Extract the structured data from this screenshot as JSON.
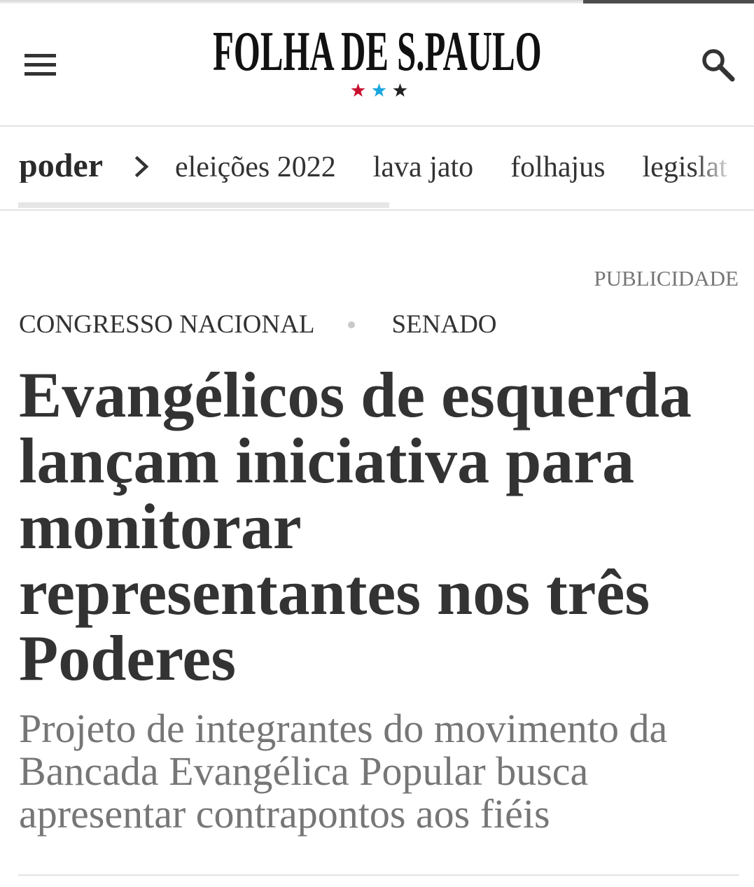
{
  "header": {
    "logo_text": "FOLHA DE S.PAULO",
    "star_colors": [
      "#c8102e",
      "#1ba6e0",
      "#222222"
    ]
  },
  "icons": {
    "menu": "hamburger-menu-icon",
    "search": "search-icon",
    "chevron": "chevron-right-icon",
    "logo_stars": "star-icon"
  },
  "nav": {
    "current_section": "poder",
    "items": [
      "eleições 2022",
      "lava jato",
      "folhajus",
      "legislat"
    ]
  },
  "ad": {
    "label": "PUBLICIDADE"
  },
  "article": {
    "kicker": [
      "CONGRESSO NACIONAL",
      "SENADO"
    ],
    "headline": "Evangélicos de esquerda lançam iniciativa para monitorar representantes nos três Poderes",
    "subtitle": "Projeto de integrantes do movimento da Bancada Evangélica Popular busca apresentar contrapontos aos fiéis"
  },
  "colors": {
    "text": "#333333",
    "muted": "#767676",
    "divider": "#e2e2e2",
    "dark": "#4d4d4d"
  }
}
